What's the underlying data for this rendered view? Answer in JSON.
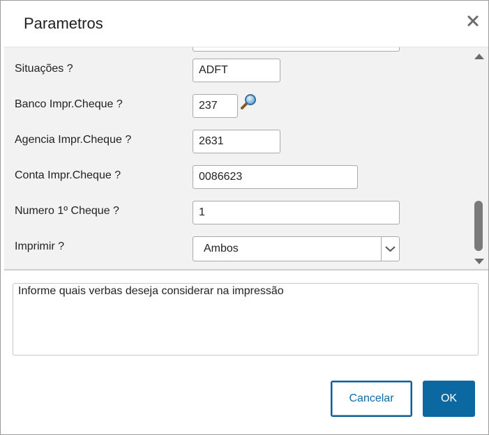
{
  "dialog": {
    "title": "Parametros",
    "close_icon": "close-icon"
  },
  "params": [
    {
      "label": "Situações ?",
      "value": "ADFT",
      "type": "text"
    },
    {
      "label": "Banco Impr.Cheque ?",
      "value": "237",
      "type": "lookup",
      "icon": "magnifier-icon"
    },
    {
      "label": "Agencia Impr.Cheque ?",
      "value": "2631",
      "type": "text"
    },
    {
      "label": "Conta Impr.Cheque ?",
      "value": "0086623",
      "type": "text"
    },
    {
      "label": "Numero 1º Cheque ?",
      "value": "1",
      "type": "text"
    },
    {
      "label": "Imprimir ?",
      "value": "Ambos",
      "type": "select"
    }
  ],
  "help": {
    "text": "Informe quais verbas deseja considerar na impressão"
  },
  "buttons": {
    "cancel": "Cancelar",
    "ok": "OK"
  },
  "colors": {
    "primary": "#0b68a1",
    "panel_bg": "#f2f2f2",
    "border": "#a9a9a9"
  }
}
